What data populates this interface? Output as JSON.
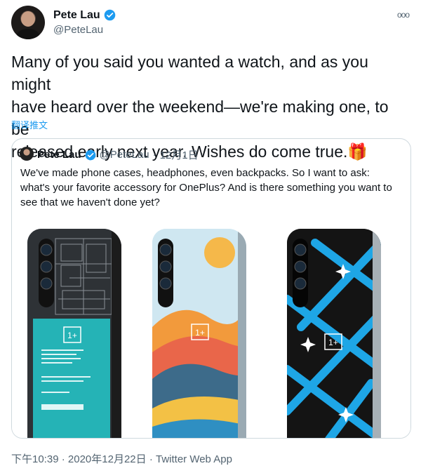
{
  "author": {
    "name": "Pete Lau",
    "handle": "@PeteLau"
  },
  "more_label": "ooo",
  "tweet": {
    "line1": "Many of you said you wanted a watch, and as you might",
    "line2": "have heard over the weekend—we're making one, to be",
    "line3": "released early next year. Wishes do come true.",
    "emoji": "🎁",
    "translate_label": "翻译推文"
  },
  "quote": {
    "name": "Pete Lau",
    "handle": "@PeteLau",
    "separator": "·",
    "date": "12月1日",
    "line1": "We've made phone cases, headphones, even backpacks. So I want to ask:",
    "line2": "what's your favorite accessory for OnePlus? And is there something you want to",
    "line3": "see that we haven't done yet?",
    "brand_logo": "1+",
    "images": [
      {
        "name": "circuit-board-case"
      },
      {
        "name": "landscape-art-case"
      },
      {
        "name": "blue-pattern-case"
      }
    ]
  },
  "footer": {
    "time": "下午10:39",
    "sep1": "·",
    "date": "2020年12月22日",
    "sep2": "·",
    "client": "Twitter Web App"
  },
  "colors": {
    "verified": "#1d9bf0",
    "link": "#1d9bf0",
    "muted": "#536471",
    "border": "#cfd9de"
  }
}
